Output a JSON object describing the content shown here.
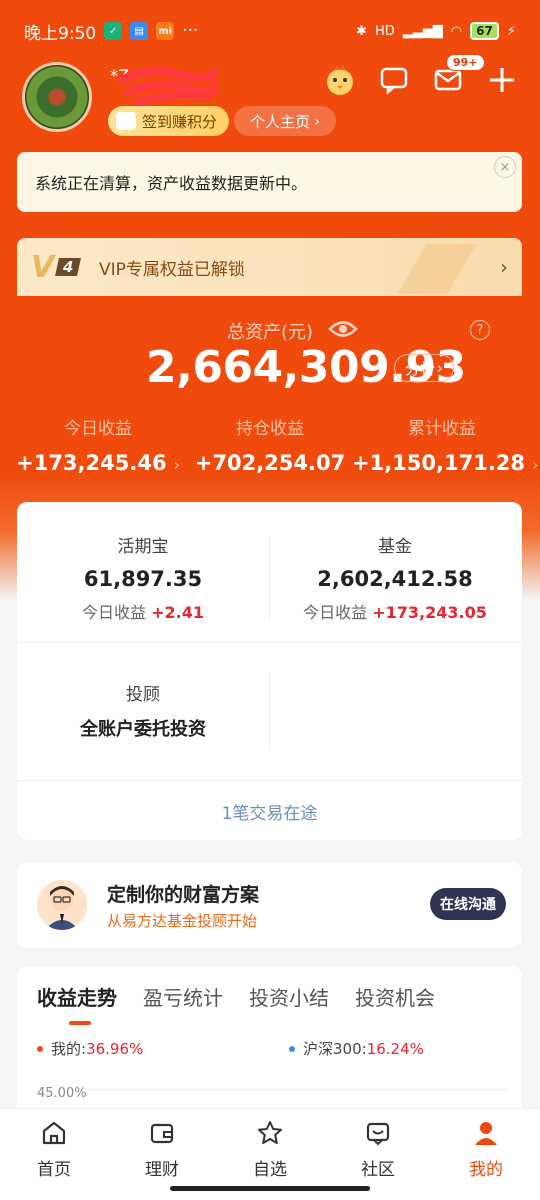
{
  "status_bar": {
    "time": "晚上9:50",
    "battery": "67",
    "network": "HD"
  },
  "header": {
    "username": "*Z",
    "checkin_label": "签到赚积分",
    "homepage_label": "个人主页",
    "mail_badge": "99+"
  },
  "notice": {
    "text": "系统正在清算，资产收益数据更新中。",
    "close": "×"
  },
  "vip": {
    "level": "4",
    "text": "VIP专属权益已解锁"
  },
  "assets": {
    "title": "总资产(元)",
    "total": "2,664,309.93",
    "analyze_label": "分析",
    "help": "?",
    "stats": [
      {
        "label": "今日收益",
        "value": "+173,245.46"
      },
      {
        "label": "持仓收益",
        "value": "+702,254.07"
      },
      {
        "label": "累计收益",
        "value": "+1,150,171.28"
      }
    ]
  },
  "accounts": {
    "items": [
      {
        "name": "活期宝",
        "amount": "61,897.35",
        "today_label": "今日收益",
        "today_value": "+2.41"
      },
      {
        "name": "基金",
        "amount": "2,602,412.58",
        "today_label": "今日收益",
        "today_value": "+173,243.05"
      },
      {
        "name": "投顾",
        "amount": "全账户委托投资"
      }
    ],
    "pending": "1笔交易在途"
  },
  "advisor": {
    "title": "定制你的财富方案",
    "subtitle": "从易方达基金投顾开始",
    "contact_label": "在线沟通"
  },
  "trend": {
    "tabs": [
      "收益走势",
      "盈亏统计",
      "投资小结",
      "投资机会"
    ],
    "active_tab": 0,
    "mine_label": "我的:",
    "mine_value": "36.96%",
    "index_label": "沪深300:",
    "index_value": "16.24%",
    "y_top": "45.00%",
    "colors": {
      "mine": "#f04a0d",
      "index": "#3b8ee8"
    }
  },
  "nav": {
    "items": [
      "首页",
      "理财",
      "自选",
      "社区",
      "我的"
    ],
    "active": 4
  },
  "colors": {
    "brand": "#f04a0d",
    "positive": "#e8262d",
    "advisor_button": "#2e3552"
  }
}
